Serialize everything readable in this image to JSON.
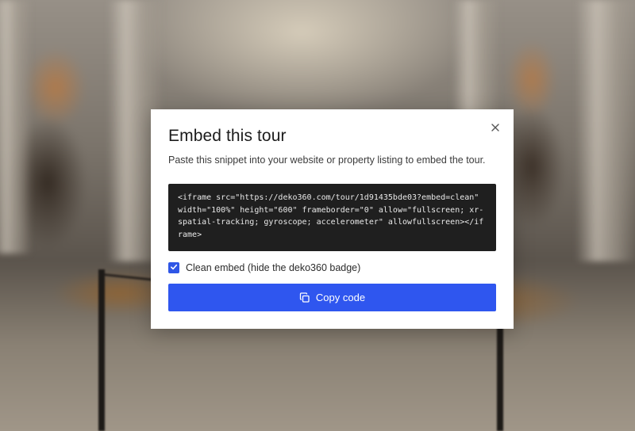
{
  "modal": {
    "title": "Embed this tour",
    "description": "Paste this snippet into your website or property listing to embed the tour.",
    "code_snippet": "<iframe src=\"https://deko360.com/tour/1d91435bde03?embed=clean\" width=\"100%\" height=\"600\" frameborder=\"0\" allow=\"fullscreen; xr-spatial-tracking; gyroscope; accelerometer\" allowfullscreen></iframe>",
    "clean_embed": {
      "label": "Clean embed (hide the deko360 badge)",
      "checked": true
    },
    "copy_button_label": "Copy code",
    "close_icon": "close-icon",
    "copy_icon": "copy-icon",
    "check_icon": "check-icon"
  },
  "colors": {
    "accent": "#2f56ef",
    "code_background": "#1f1f1f",
    "modal_background": "#ffffff"
  }
}
